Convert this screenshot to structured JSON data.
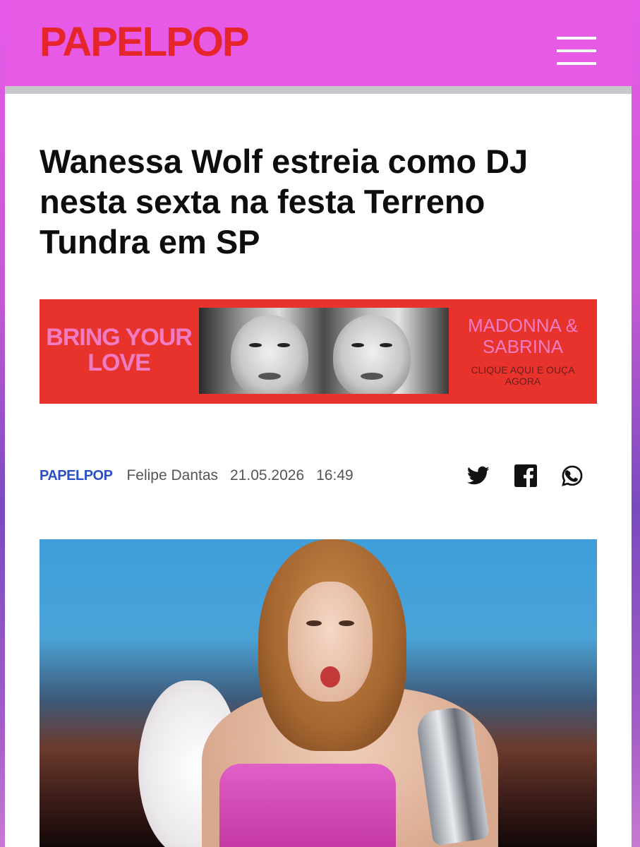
{
  "header": {
    "logo": "PAPELPOP",
    "menu_icon": "hamburger-menu-icon",
    "background_color": "#e65ae6",
    "logo_color": "#e5252c"
  },
  "article": {
    "headline": "Wanessa Wolf estreia como DJ nesta sexta na festa Terreno Tundra em SP"
  },
  "ad": {
    "left_text": "BRING YOUR LOVE",
    "right_title": "MADONNA & SABRINA",
    "right_cta": "CLIQUE AQUI E OUÇA AGORA",
    "background_color": "#e8332d",
    "accent_color": "#f27cc4"
  },
  "meta": {
    "brand": "PAPELPOP",
    "author": "Felipe Dantas",
    "date": "21.05.2026",
    "time": "16:49",
    "brand_color": "#2b4fc4",
    "share": [
      {
        "icon": "twitter-icon"
      },
      {
        "icon": "facebook-icon"
      },
      {
        "icon": "whatsapp-icon"
      }
    ]
  }
}
